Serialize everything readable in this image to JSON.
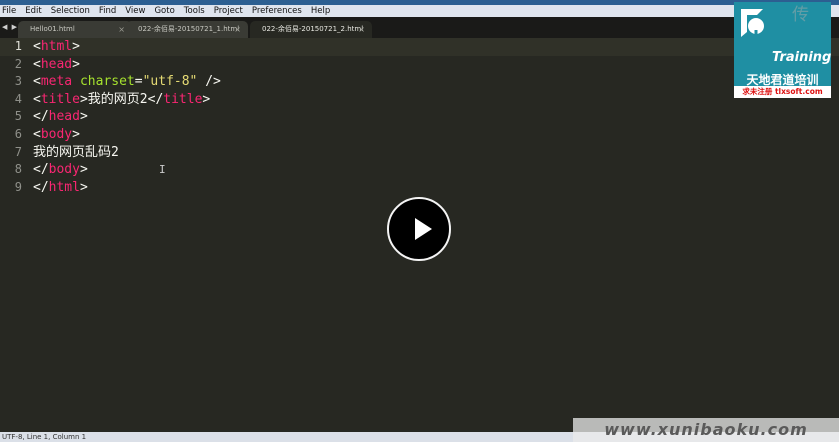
{
  "menubar": {
    "items": [
      "File",
      "Edit",
      "Selection",
      "Find",
      "View",
      "Goto",
      "Tools",
      "Project",
      "Preferences",
      "Help"
    ]
  },
  "tabbar": {
    "nav_arrows": "◀ ▶",
    "tabs": [
      {
        "label": "Hello01.html",
        "close": "×"
      },
      {
        "label": "022-余佰易-20150721_1.html",
        "close": "×"
      },
      {
        "label": "022-余佰易-20150721_2.html",
        "close": "×"
      }
    ],
    "active_tab": 2
  },
  "editor": {
    "line_numbers": [
      "1",
      "2",
      "3",
      "4",
      "5",
      "6",
      "7",
      "8",
      "9"
    ],
    "current_line": 1,
    "lines": [
      [
        {
          "t": "p",
          "v": "<"
        },
        {
          "t": "tag",
          "v": "html"
        },
        {
          "t": "p",
          "v": ">"
        }
      ],
      [
        {
          "t": "p",
          "v": "<"
        },
        {
          "t": "tag",
          "v": "head"
        },
        {
          "t": "p",
          "v": ">"
        }
      ],
      [
        {
          "t": "p",
          "v": "<"
        },
        {
          "t": "tag",
          "v": "meta"
        },
        {
          "t": "p",
          "v": " "
        },
        {
          "t": "attr",
          "v": "charset"
        },
        {
          "t": "p",
          "v": "="
        },
        {
          "t": "str",
          "v": "\"utf-8\""
        },
        {
          "t": "p",
          "v": " />"
        }
      ],
      [
        {
          "t": "p",
          "v": "<"
        },
        {
          "t": "tag",
          "v": "title"
        },
        {
          "t": "p",
          "v": ">我的网页2</"
        },
        {
          "t": "tag",
          "v": "title"
        },
        {
          "t": "p",
          "v": ">"
        }
      ],
      [
        {
          "t": "p",
          "v": "</"
        },
        {
          "t": "tag",
          "v": "head"
        },
        {
          "t": "p",
          "v": ">"
        }
      ],
      [
        {
          "t": "p",
          "v": "<"
        },
        {
          "t": "tag",
          "v": "body"
        },
        {
          "t": "p",
          "v": ">"
        }
      ],
      [
        {
          "t": "p",
          "v": "我的网页乱码2"
        }
      ],
      [
        {
          "t": "p",
          "v": "</"
        },
        {
          "t": "tag",
          "v": "body"
        },
        {
          "t": "p",
          "v": ">"
        }
      ],
      [
        {
          "t": "p",
          "v": "</"
        },
        {
          "t": "tag",
          "v": "html"
        },
        {
          "t": "p",
          "v": ">"
        }
      ]
    ],
    "cursor_glyph": "I"
  },
  "video": {
    "play_icon": "play-icon"
  },
  "logo": {
    "training": "Training",
    "name_cn": "天地君道培训",
    "sub": "求未注册 tlxsoft.com"
  },
  "corner_mark": "传",
  "statusbar": {
    "text": "UTF-8, Line 1, Column 1"
  },
  "watermark": {
    "text": "www.xunibaoku.com"
  },
  "colors": {
    "editor_bg": "#272822",
    "tag": "#f92672",
    "attribute": "#a6e22e",
    "string": "#e6db74",
    "text": "#f8f8f2",
    "logo_bg": "#1f8fa3"
  }
}
